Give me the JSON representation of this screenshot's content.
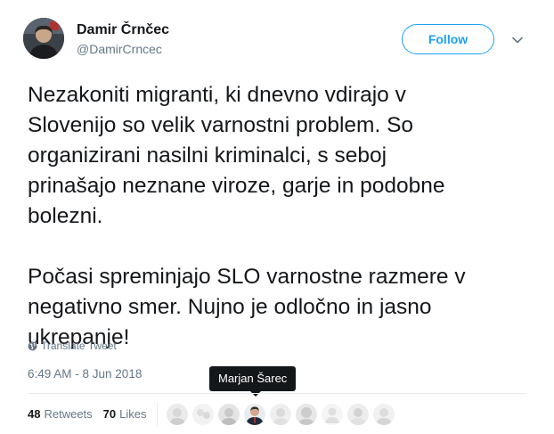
{
  "user": {
    "fullname": "Damir Črnčec",
    "username": "@DamirCrncec"
  },
  "follow_label": "Follow",
  "tweet": {
    "paragraph1": "Nezakoniti migranti, ki dnevno vdirajo v\nSlovenijo so velik varnostni problem. So\norganizirani nasilni kriminalci, s seboj\nprinašajo neznane viroze, garje in podobne\nbolezni.",
    "paragraph2": "Počasi spreminjajo SLO varnostne razmere v\nnegativno smer. Nujno je odločno in jasno\nukrepanje!"
  },
  "translate_label": "Translate Tweet",
  "timestamp": "6:49 AM - 8 Jun 2018",
  "tooltip": "Marjan Šarec",
  "stats": {
    "retweets_count": "48",
    "retweets_label": "Retweets",
    "likes_count": "70",
    "likes_label": "Likes"
  },
  "colors": {
    "accent": "#1da1f2",
    "muted": "#657786",
    "text": "#14171a"
  },
  "icons": {
    "caret": "chevron-down-icon",
    "globe": "globe-icon"
  }
}
